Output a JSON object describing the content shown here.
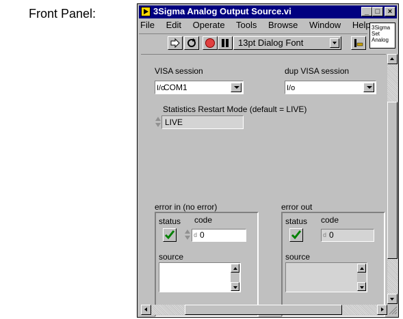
{
  "heading": "Front Panel:",
  "window": {
    "title": "3Sigma Analog Output Source.vi",
    "controls": {
      "minimize": "_",
      "maximize": "□",
      "close": "×"
    }
  },
  "menu": [
    "File",
    "Edit",
    "Operate",
    "Tools",
    "Browse",
    "Window",
    "Help"
  ],
  "toolbar": {
    "font": "13pt Dialog Font",
    "icons": [
      "run-arrow-icon",
      "run-continuously-icon",
      "abort-icon",
      "pause-icon",
      "alignment-icon"
    ]
  },
  "vi_icon": {
    "line1": "3Sigma",
    "line2": "Set",
    "line3": "Analog"
  },
  "controls": {
    "visa_session": {
      "label": "VISA session",
      "io": "I/o",
      "value": "COM1"
    },
    "dup_visa_session": {
      "label": "dup VISA session",
      "io": "I/o",
      "value": ""
    },
    "restart_mode": {
      "label": "Statistics Restart Mode (default = LIVE)",
      "value": "LIVE"
    },
    "error_in": {
      "label": "error in (no error)",
      "status_label": "status",
      "code_label": "code",
      "code_value": "0",
      "source_label": "source",
      "radix": "d",
      "status_ok": true
    },
    "error_out": {
      "label": "error out",
      "status_label": "status",
      "code_label": "code",
      "code_value": "0",
      "source_label": "source",
      "radix": "d",
      "status_ok": true
    }
  },
  "colors": {
    "titlebar": "#000080",
    "face": "#c0c0c0",
    "check": "#008000"
  }
}
